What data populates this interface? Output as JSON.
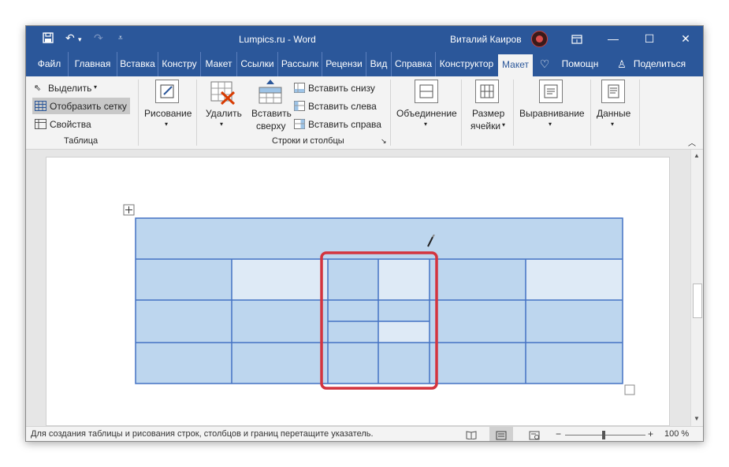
{
  "titlebar": {
    "title": "Lumpics.ru  -  Word",
    "user": "Виталий Каиров",
    "icons": [
      "save-icon",
      "undo-icon",
      "redo-icon",
      "customize-qat-icon",
      "ribbon-display-icon",
      "minimize-icon",
      "maximize-icon",
      "close-icon"
    ]
  },
  "tabs": [
    "Файл",
    "Главная",
    "Вставка",
    "Констру",
    "Макет",
    "Ссылки",
    "Рассылк",
    "Рецензи",
    "Вид",
    "Справка",
    "Конструктор",
    "Макет",
    "Помощн",
    "Поделиться"
  ],
  "active_tab": "Макет",
  "accent_color": "#2b579a",
  "ribbon": {
    "table_group": {
      "select": "Выделить",
      "view_gridlines": "Отобразить сетку",
      "properties": "Свойства",
      "label": "Таблица"
    },
    "draw": "Рисование",
    "delete": "Удалить",
    "insert_above_1": "Вставить",
    "insert_above_2": "сверху",
    "insert_below": "Вставить снизу",
    "insert_left": "Вставить слева",
    "insert_right": "Вставить справа",
    "rows_cols_label": "Строки и столбцы",
    "merge": "Объединение",
    "cell_size_1": "Размер",
    "cell_size_2": "ячейки",
    "alignment": "Выравнивание",
    "data": "Данные"
  },
  "status": {
    "message": "Для создания таблицы и рисования строк, столбцов и границ перетащите указатель.",
    "zoom": "100 %",
    "minus": "−",
    "plus": "+"
  },
  "table": {
    "cell_color_dark": "#bdd6ee",
    "cell_color_light": "#deeaf6",
    "border_color": "#4472c4",
    "highlight_color": "#d3343e"
  }
}
